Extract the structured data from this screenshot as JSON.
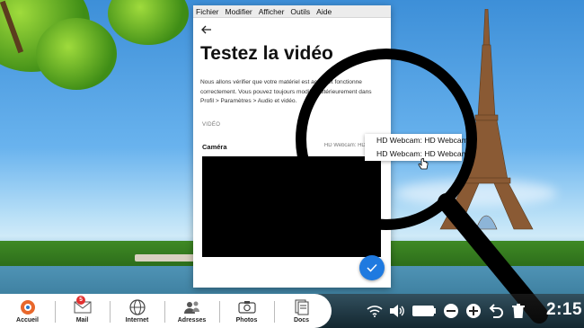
{
  "window": {
    "menu": [
      "Fichier",
      "Modifier",
      "Afficher",
      "Outils",
      "Aide"
    ],
    "back_icon": "arrow-left-icon",
    "title": "Testez la vidéo",
    "description": "Nous allons vérifier que votre matériel est activé et fonctionne correctement. Vous pouvez toujours modifier ultérieurement dans Profil > Paramètres > Audio et vidéo.",
    "section_label": "VIDÉO",
    "camera_label": "Caméra",
    "camera_value": "HD Webcam: HD Webcam",
    "confirm_icon": "checkmark-icon",
    "accent_color": "#1f7ae0"
  },
  "dropdown": {
    "options": [
      "HD Webcam: HD Webcam",
      "HD Webcam: HD Webcam"
    ]
  },
  "taskbar": {
    "dock": [
      {
        "label": "Accueil",
        "icon": "home-logo-icon"
      },
      {
        "label": "Mail",
        "icon": "mail-icon",
        "badge": "5"
      },
      {
        "label": "Internet",
        "icon": "globe-icon"
      },
      {
        "label": "Adresses",
        "icon": "contacts-icon"
      },
      {
        "label": "Photos",
        "icon": "camera-icon"
      },
      {
        "label": "Docs",
        "icon": "documents-icon"
      }
    ],
    "tray": [
      "wifi-icon",
      "volume-icon",
      "battery-icon",
      "minus-icon",
      "plus-icon",
      "undo-icon",
      "trash-icon"
    ],
    "clock": "2:15"
  }
}
